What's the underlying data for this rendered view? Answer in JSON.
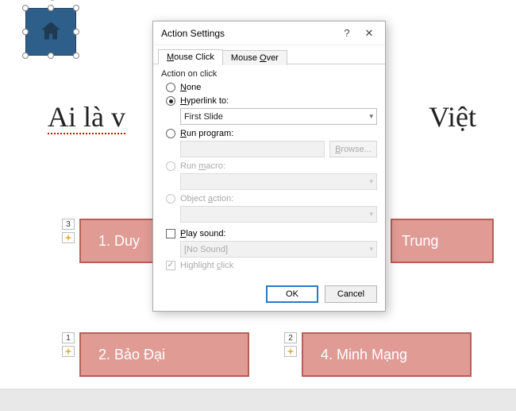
{
  "slide": {
    "title_left": "Ai là v",
    "title_right": "Việt",
    "right_trunc": "Trung",
    "house_icon": "home-icon",
    "answers": {
      "a1": "1. Duy",
      "a2": "2. Bảo Đại",
      "a3": "Trung",
      "a4": "4. Minh Mạng"
    },
    "anim_tags": {
      "t1": "1",
      "t2": "2",
      "t3": "3"
    }
  },
  "dialog": {
    "title": "Action Settings",
    "help_glyph": "?",
    "close_glyph": "✕",
    "tabs": {
      "click": "Mouse Click",
      "over": "Mouse Over"
    },
    "section_label": "Action on click",
    "opts": {
      "none": "None",
      "hyperlink": "Hyperlink to:",
      "hyperlink_value": "First Slide",
      "run_program": "Run program:",
      "browse": "Browse...",
      "run_macro": "Run macro:",
      "object_action": "Object action:"
    },
    "sound": {
      "play_label": "Play sound:",
      "value": "[No Sound]",
      "highlight": "Highlight click"
    },
    "buttons": {
      "ok": "OK",
      "cancel": "Cancel"
    }
  }
}
